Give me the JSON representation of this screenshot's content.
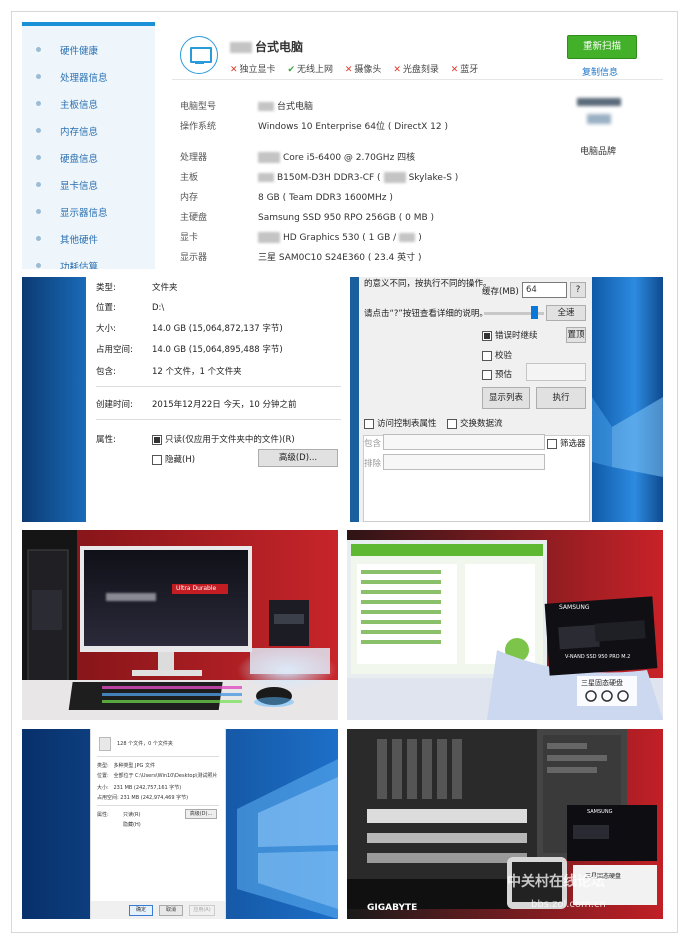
{
  "hardware_panel": {
    "sidebar": [
      {
        "label": "硬件健康"
      },
      {
        "label": "处理器信息"
      },
      {
        "label": "主板信息"
      },
      {
        "label": "内存信息"
      },
      {
        "label": "硬盘信息"
      },
      {
        "label": "显卡信息"
      },
      {
        "label": "显示器信息"
      },
      {
        "label": "其他硬件"
      },
      {
        "label": "功耗估算"
      }
    ],
    "title": "台式电脑",
    "tags": [
      {
        "mark": "✕",
        "label": "独立显卡",
        "status": "no"
      },
      {
        "mark": "✔",
        "label": "无线上网",
        "status": "yes"
      },
      {
        "mark": "✕",
        "label": "摄像头",
        "status": "no"
      },
      {
        "mark": "✕",
        "label": "光盘刻录",
        "status": "no"
      },
      {
        "mark": "✕",
        "label": "蓝牙",
        "status": "no"
      }
    ],
    "rescan_button": "重新扫描",
    "copy_link": "复制信息",
    "brand_label": "电脑品牌",
    "rows": [
      {
        "key": "电脑型号",
        "value": "台式电脑"
      },
      {
        "key": "操作系统",
        "value": "Windows 10 Enterprise 64位 ( DirectX 12 )"
      },
      {
        "key": "处理器",
        "value": "Core i5-6400 @ 2.70GHz 四核"
      },
      {
        "key": "主板",
        "value": "B150M-D3H DDR3-CF (",
        "value2": "Skylake-S )"
      },
      {
        "key": "内存",
        "value": "8 GB ( Team DDR3 1600MHz )"
      },
      {
        "key": "主硬盘",
        "value": "Samsung  SSD  950 RPO  256GB ( 0 MB )"
      },
      {
        "key": "显卡",
        "value": "HD Graphics 530 ( 1 GB /",
        "value2": ")"
      },
      {
        "key": "显示器",
        "value": "三星 SAM0C10 S24E360 ( 23.4 英寸 )"
      }
    ],
    "accent": "#1a90d6",
    "button_color": "#43b02a"
  },
  "properties_panel": {
    "rows": [
      {
        "key": "类型:",
        "value": "文件夹"
      },
      {
        "key": "位置:",
        "value": "D:\\"
      },
      {
        "key": "大小:",
        "value": "14.0 GB (15,064,872,137 字节)"
      },
      {
        "key": "占用空间:",
        "value": "14.0 GB (15,064,895,488 字节)"
      },
      {
        "key": "包含:",
        "value": "12 个文件，1 个文件夹"
      }
    ],
    "created_key": "创建时间:",
    "created_value": "2015年12月22日 今天，10 分钟之前",
    "attr_key": "属性:",
    "readonly_label": "只读(仅应用于文件夹中的文件)(R)",
    "hidden_label": "隐藏(H)",
    "advanced_button": "高级(D)...",
    "right": {
      "text1": "的意义不同，按执行不同的操作。",
      "text2": "请点击“?”按钮查看详细的说明。",
      "cache_label": "缓存(MB)",
      "cache_value": "64",
      "help_button": "?",
      "full_speed_button": "全速",
      "continue_on_error": "错误时继续",
      "reset_button": "置顶",
      "verify": "校验",
      "preview": "预估",
      "show_list_button": "显示列表",
      "execute_button": "执行",
      "acl_check": "访问控制表属性",
      "swap_check": "交换数据流",
      "include_label": "包含",
      "exclude_label": "排除",
      "filter_check": "筛选器"
    }
  },
  "photo_panels": {
    "monitor_banner": "Ultra Durable",
    "samsung_logo": "SAMSUNG",
    "ssd_label": "V-NAND SSD 950 PRO M.2",
    "box_caption": "三星固态硬盘",
    "gigabyte_text": "GIGABYTE",
    "small_dialog": {
      "header": "128 个文件，0 个文件夹",
      "rows": [
        {
          "key": "类型:",
          "value": "多种类型 JPG 文件"
        },
        {
          "key": "位置:",
          "value": "全部位于 C:\\Users\\Win10\\Desktop\\测试照片"
        },
        {
          "key": "大小:",
          "value": "231 MB (242,757,161 字节)"
        },
        {
          "key": "占用空间:",
          "value": "231 MB (242,974,469 字节)"
        }
      ],
      "attr_key": "属性:",
      "readonly": "只读(R)",
      "hidden": "隐藏(H)",
      "advanced": "高级(D)...",
      "ok": "确定",
      "cancel": "取消",
      "apply": "应用(A)"
    },
    "watermark_text": "中关村在线论坛",
    "watermark_url": "bbs.zol.com.cn"
  }
}
